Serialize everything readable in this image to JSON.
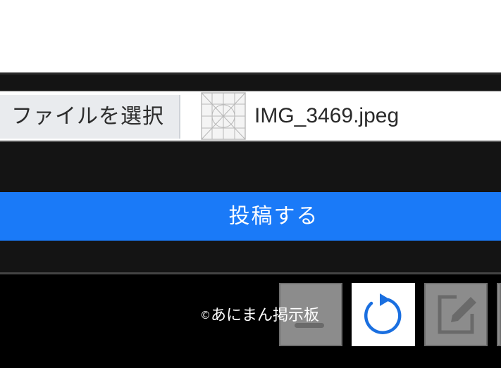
{
  "file_input": {
    "button_label": "ファイルを選択",
    "file_name": "IMG_3469.jpeg"
  },
  "submit": {
    "label": "投稿する"
  },
  "footer": {
    "copyright_symbol": "©",
    "site_name": "あにまん掲示板"
  },
  "toolbar": {
    "items": [
      {
        "icon": "scroll-bottom-icon",
        "state": "disabled"
      },
      {
        "icon": "reload-icon",
        "state": "active"
      },
      {
        "icon": "edit-icon",
        "state": "disabled"
      }
    ]
  },
  "colors": {
    "submit_bg": "#1a7af8",
    "reload_icon": "#1a6fe0",
    "disabled_btn": "#8c8c8c"
  }
}
